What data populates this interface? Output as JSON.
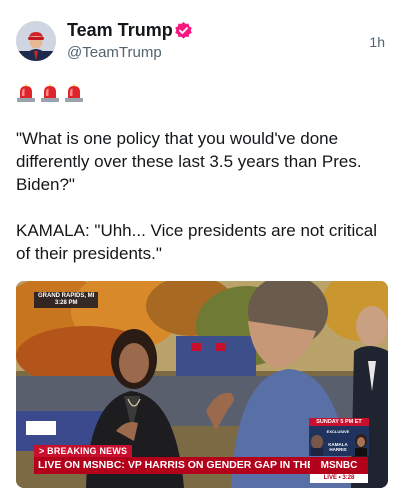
{
  "post": {
    "author": {
      "display_name": "Team Trump",
      "handle": "@TeamTrump",
      "verified": true,
      "avatar_icon": "avatar-photo"
    },
    "timestamp": "1h",
    "emoji_icons": [
      "police-siren-icon",
      "police-siren-icon",
      "police-siren-icon"
    ],
    "text": {
      "paragraph_1": "\"What is one policy that you would've done differently over these last 3.5 years than Pres. Biden?\"",
      "paragraph_2": "KAMALA: \"Uhh... Vice presidents are not critical of their presidents.\""
    },
    "media": {
      "location_bug": {
        "place": "GRAND RAPIDS, MI",
        "time": "3:28 PM"
      },
      "breaking_label": "> BREAKING NEWS",
      "headline": "LIVE ON MSNBC: VP HARRIS ON GENDER GAP IN THE POLLS",
      "network_logo": "MSNBC",
      "live_bar": "LIVE • 3:28",
      "promo": {
        "time": "SUNDAY 5 PM ET",
        "tag": "EXCLUSIVE",
        "name": "KAMALA HARRIS"
      }
    }
  },
  "colors": {
    "verified_badge": "#f91880",
    "news_red": "#b3001b",
    "secondary_text": "#536471"
  }
}
